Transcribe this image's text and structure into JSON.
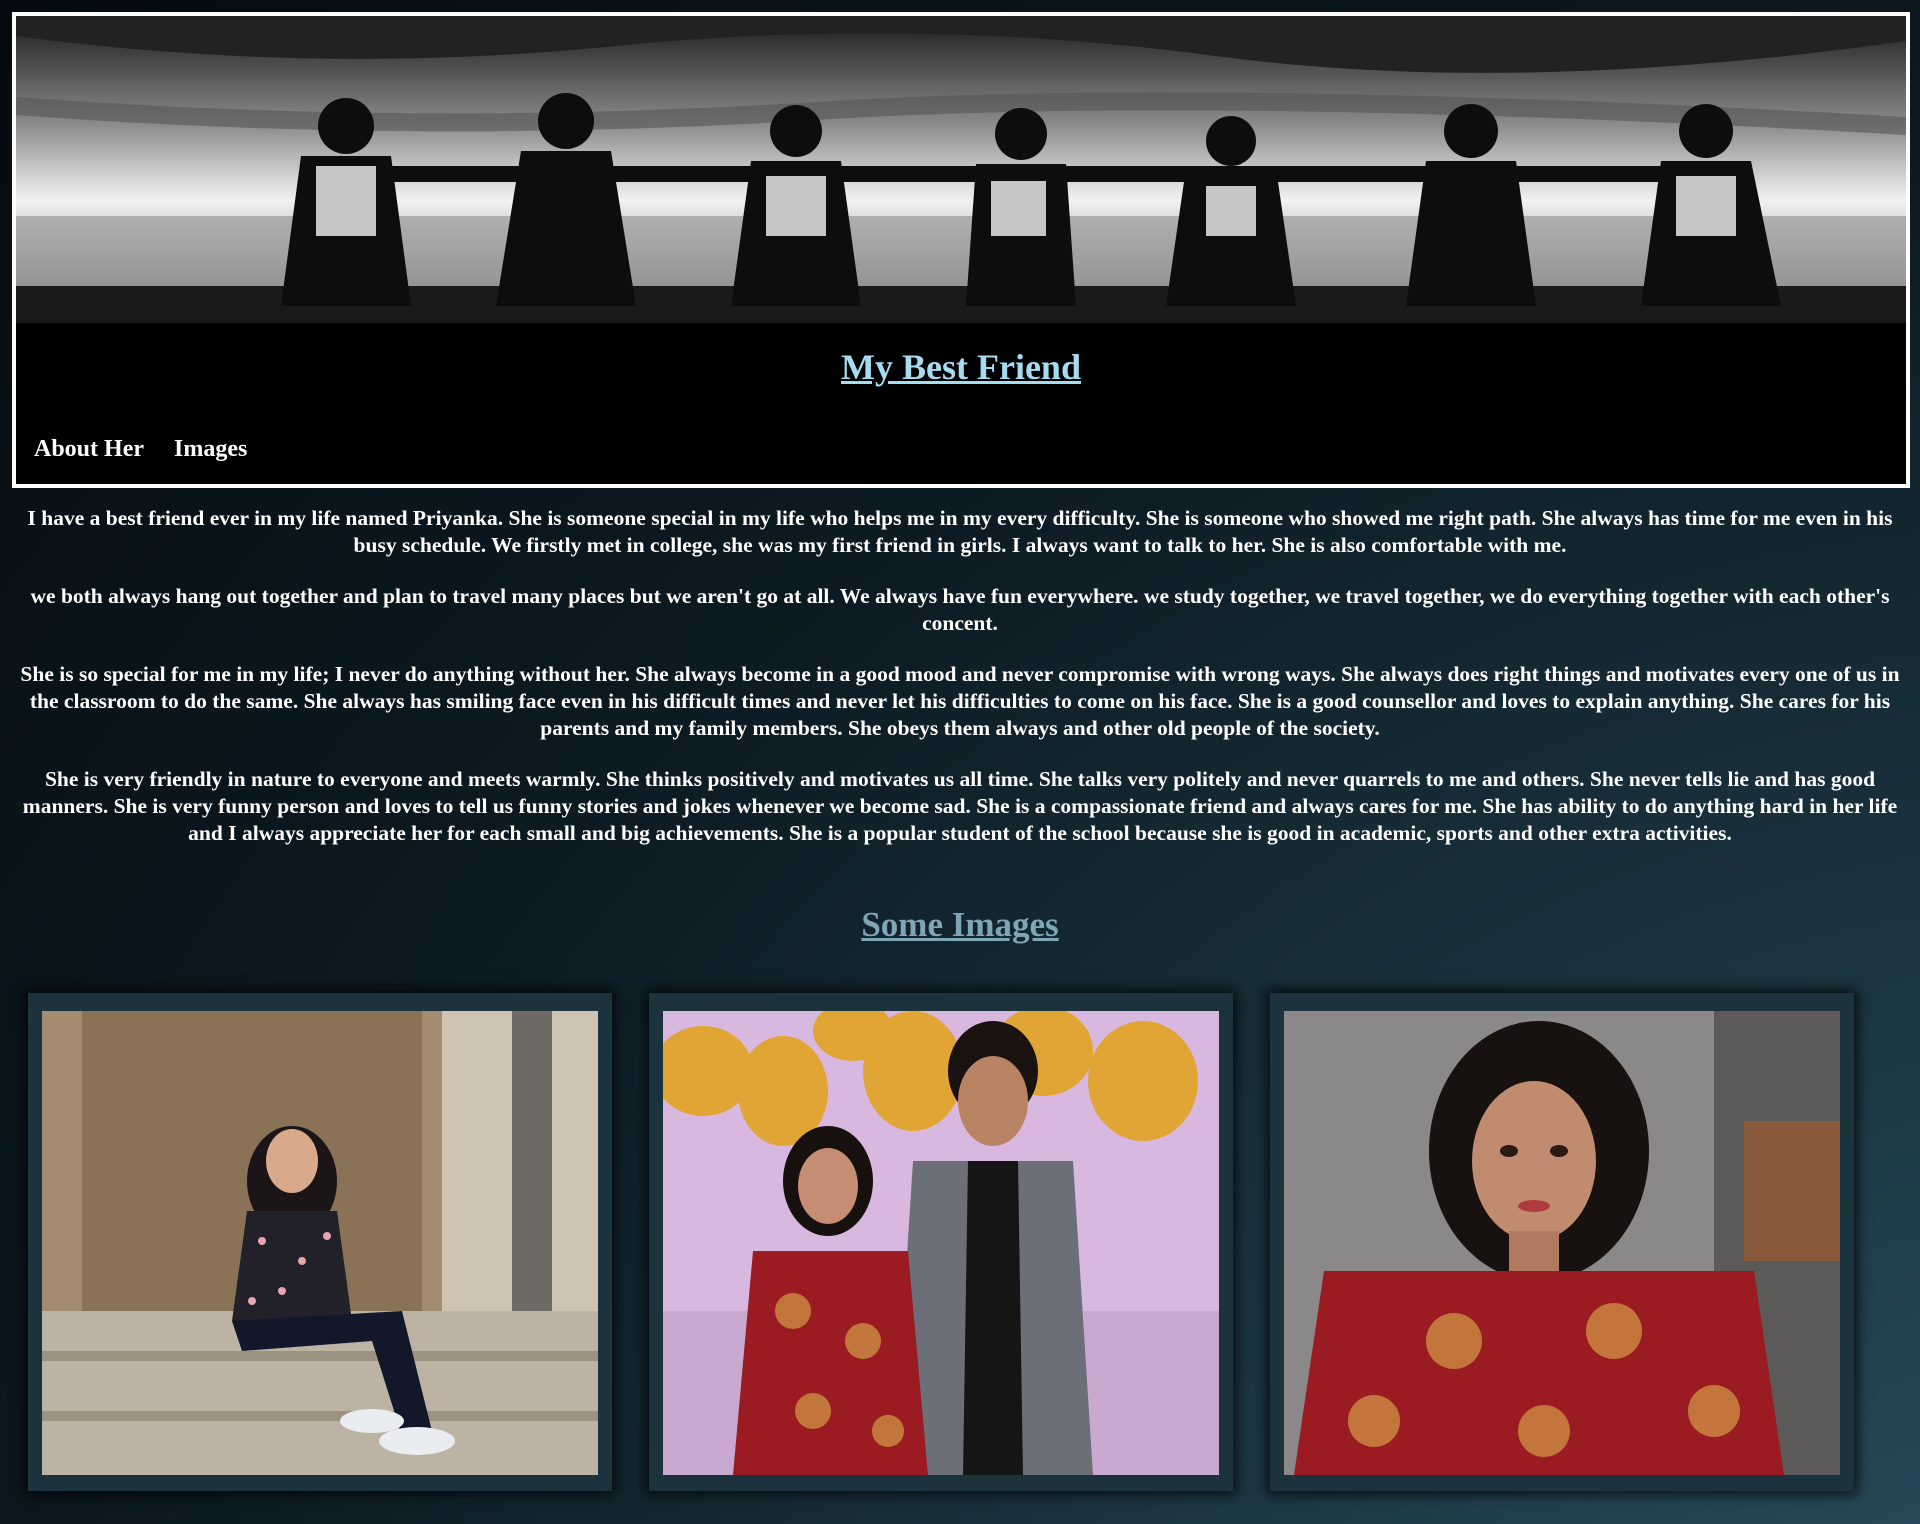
{
  "header": {
    "title": "My Best Friend",
    "banner_icon": "friends-silhouette-photo"
  },
  "nav": {
    "items": [
      "About Her",
      "Images"
    ]
  },
  "about": {
    "paragraphs": [
      "I have a best friend ever in my life named Priyanka. She is someone special in my life who helps me in my every difficulty. She is someone who showed me right path. She always has time for me even in his busy schedule. We firstly met in college, she was my first friend in girls. I always want to talk to her. She is also comfortable with me.",
      "we both always hang out together and plan to travel many places but we aren't go at all. We always have fun everywhere. we study together, we travel together, we do everything together with each other's concent.",
      "She is so special for me in my life; I never do anything without her. She always become in a good mood and never compromise with wrong ways. She always does right things and motivates every one of us in the classroom to do the same. She always has smiling face even in his difficult times and never let his difficulties to come on his face. She is a good counsellor and loves to explain anything. She cares for his parents and my family members. She obeys them always and other old people of the society.",
      "She is very friendly in nature to everyone and meets warmly. She thinks positively and motivates us all time. She talks very politely and never quarrels to me and others. She never tells lie and has good manners. She is very funny person and loves to tell us funny stories and jokes whenever we become sad. She is a compassionate friend and always cares for me. She has ability to do anything hard in her life and I always appreciate her for each small and big achievements. She is a popular student of the school because she is good in academic, sports and other extra activities."
    ]
  },
  "images_section": {
    "title": "Some Images",
    "photos": [
      {
        "icon": "girl-sitting-on-steps-photo"
      },
      {
        "icon": "couple-at-party-photo"
      },
      {
        "icon": "girl-portrait-photo"
      }
    ]
  },
  "colors": {
    "title": "#a6dcef",
    "section_title": "#7fa5b6",
    "frame": "#1c323d",
    "dress_red": "#9a1b22"
  }
}
